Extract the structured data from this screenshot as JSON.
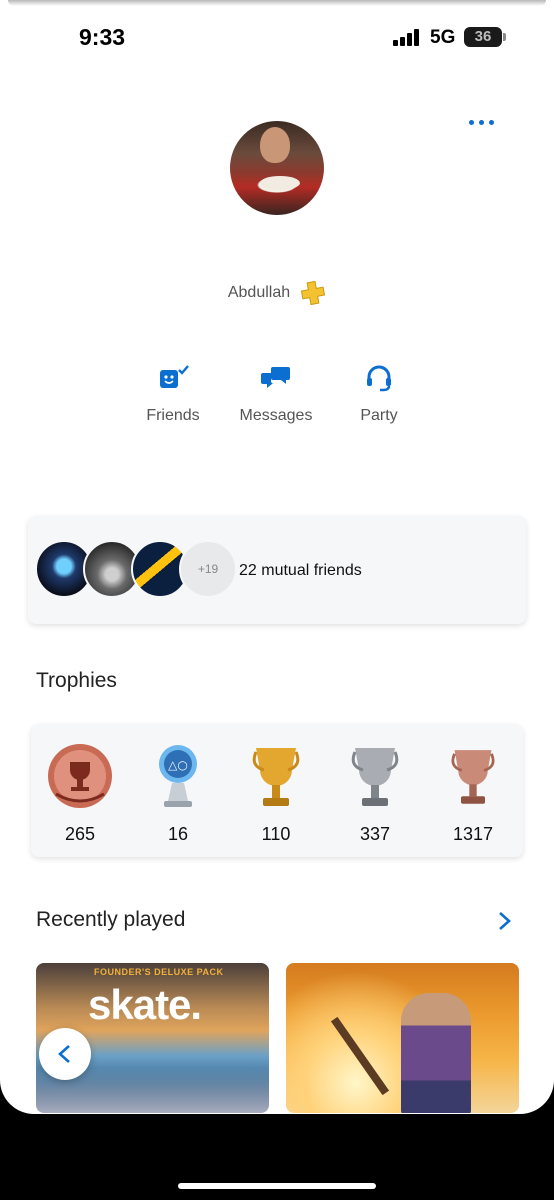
{
  "status_bar": {
    "time": "9:33",
    "network": "5G",
    "battery": "36"
  },
  "profile": {
    "username": "Abdullah"
  },
  "actions": [
    {
      "id": "friends",
      "label": "Friends"
    },
    {
      "id": "messages",
      "label": "Messages"
    },
    {
      "id": "party",
      "label": "Party"
    }
  ],
  "mutual_friends": {
    "extra_count": "+19",
    "label": "22 mutual friends"
  },
  "trophies": {
    "title": "Trophies",
    "items": [
      {
        "type": "level",
        "count": "265"
      },
      {
        "type": "platinum",
        "count": "16"
      },
      {
        "type": "gold",
        "count": "110"
      },
      {
        "type": "silver",
        "count": "337"
      },
      {
        "type": "bronze",
        "count": "1317"
      }
    ]
  },
  "recently_played": {
    "title": "Recently played",
    "games": [
      {
        "tag": "FOUNDER'S DELUXE PACK",
        "logo": "skate."
      },
      {
        "name": ""
      }
    ]
  },
  "colors": {
    "accent": "#0a6fd1",
    "gold": "#f3c230",
    "background": "#ffffff"
  },
  "icons": [
    "more-options-icon",
    "psplus-icon",
    "friends-icon",
    "messages-icon",
    "party-icon",
    "chevron-right-icon",
    "chevron-left-icon"
  ]
}
